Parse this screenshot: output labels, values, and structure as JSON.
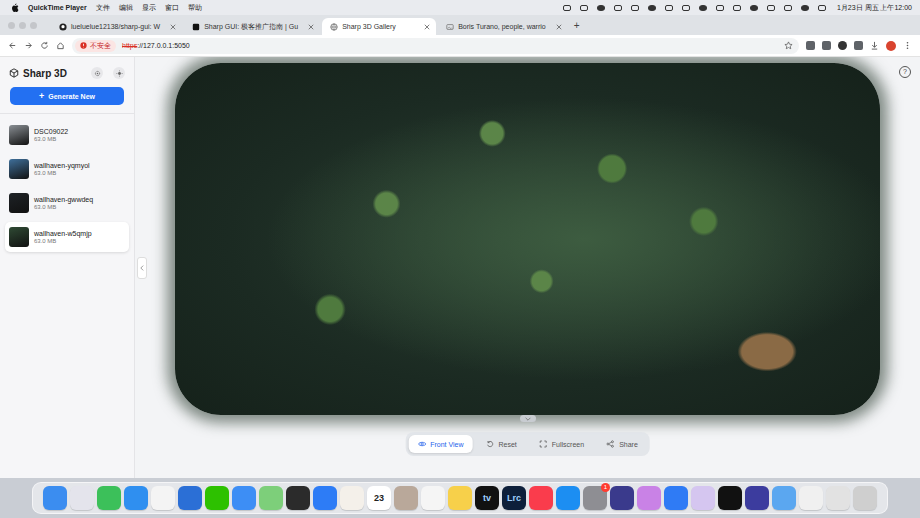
{
  "menubar": {
    "app": "QuickTime Player",
    "menus": [
      "文件",
      "编辑",
      "显示",
      "窗口",
      "帮助"
    ],
    "clock": "1月23日 周五 上午12:00"
  },
  "tabs": [
    {
      "label": "lueluelue12138/sharp-gui: W",
      "selected": false,
      "kind": "github"
    },
    {
      "label": "Sharp GUI: 极客推广指南 | Gu",
      "selected": false,
      "kind": "page"
    },
    {
      "label": "Sharp 3D Gallery",
      "selected": true,
      "kind": "globe"
    },
    {
      "label": "Boris Turano, people, warrio",
      "selected": false,
      "kind": "image"
    }
  ],
  "newTab": "+",
  "address": {
    "security": "不安全",
    "scheme": "https",
    "rest": "://127.0.0.1:5050"
  },
  "sidebar": {
    "title": "Sharp 3D",
    "plus": "+",
    "generate": "Generate New",
    "items": [
      {
        "name": "DSC09022",
        "size": "63.0 MB",
        "selected": false,
        "color": "#8a8f94"
      },
      {
        "name": "wallhaven-yqmyol",
        "size": "63.0 MB",
        "selected": false,
        "color": "#3f6f9a"
      },
      {
        "name": "wallhaven-gwwdeq",
        "size": "63.0 MB",
        "selected": false,
        "color": "#1e2226"
      },
      {
        "name": "wallhaven-w5qmjp",
        "size": "63.0 MB",
        "selected": true,
        "color": "#2f4a34"
      }
    ]
  },
  "viewer": {
    "help": "?",
    "toolbar": [
      {
        "label": "Front View",
        "selected": true,
        "kind": "eye"
      },
      {
        "label": "Reset",
        "selected": false,
        "kind": "reset"
      },
      {
        "label": "Fullscreen",
        "selected": false,
        "kind": "fullscreen"
      },
      {
        "label": "Share",
        "selected": false,
        "kind": "share"
      }
    ]
  },
  "dock": [
    {
      "color": "#3b8df0"
    },
    {
      "color": "#e4e4ec"
    },
    {
      "color": "#3cc05a"
    },
    {
      "color": "#2f8ff0"
    },
    {
      "color": "#f4f4f4"
    },
    {
      "color": "#2b6fd6"
    },
    {
      "color": "#2dc100"
    },
    {
      "color": "#3d8ef5"
    },
    {
      "color": "#7dcf7a"
    },
    {
      "color": "#2b2b2b"
    },
    {
      "color": "#2d7cf6"
    },
    {
      "color": "#f4f0ea"
    },
    {
      "color": "#ffffff",
      "label": "23"
    },
    {
      "color": "#b9a89a"
    },
    {
      "color": "#f5f5f5"
    },
    {
      "color": "#f7d04a"
    },
    {
      "color": "#111111",
      "label": "tv"
    },
    {
      "color": "#0d1f3a",
      "label": "Lrc"
    },
    {
      "color": "#fa3c4c"
    },
    {
      "color": "#1c8ef2"
    },
    {
      "color": "#8e8e93",
      "badge": "1"
    },
    {
      "color": "#3a3a8c"
    },
    {
      "color": "#c982e6"
    },
    {
      "color": "#2f7bf5"
    },
    {
      "color": "#d5c6f0"
    },
    {
      "color": "#111111"
    },
    {
      "color": "#3c3c9e"
    },
    {
      "color": "#5ba7f0"
    },
    {
      "color": "#f0f0f0"
    },
    {
      "color": "#e2e2e2"
    },
    {
      "color": "#cfcfcf"
    }
  ]
}
